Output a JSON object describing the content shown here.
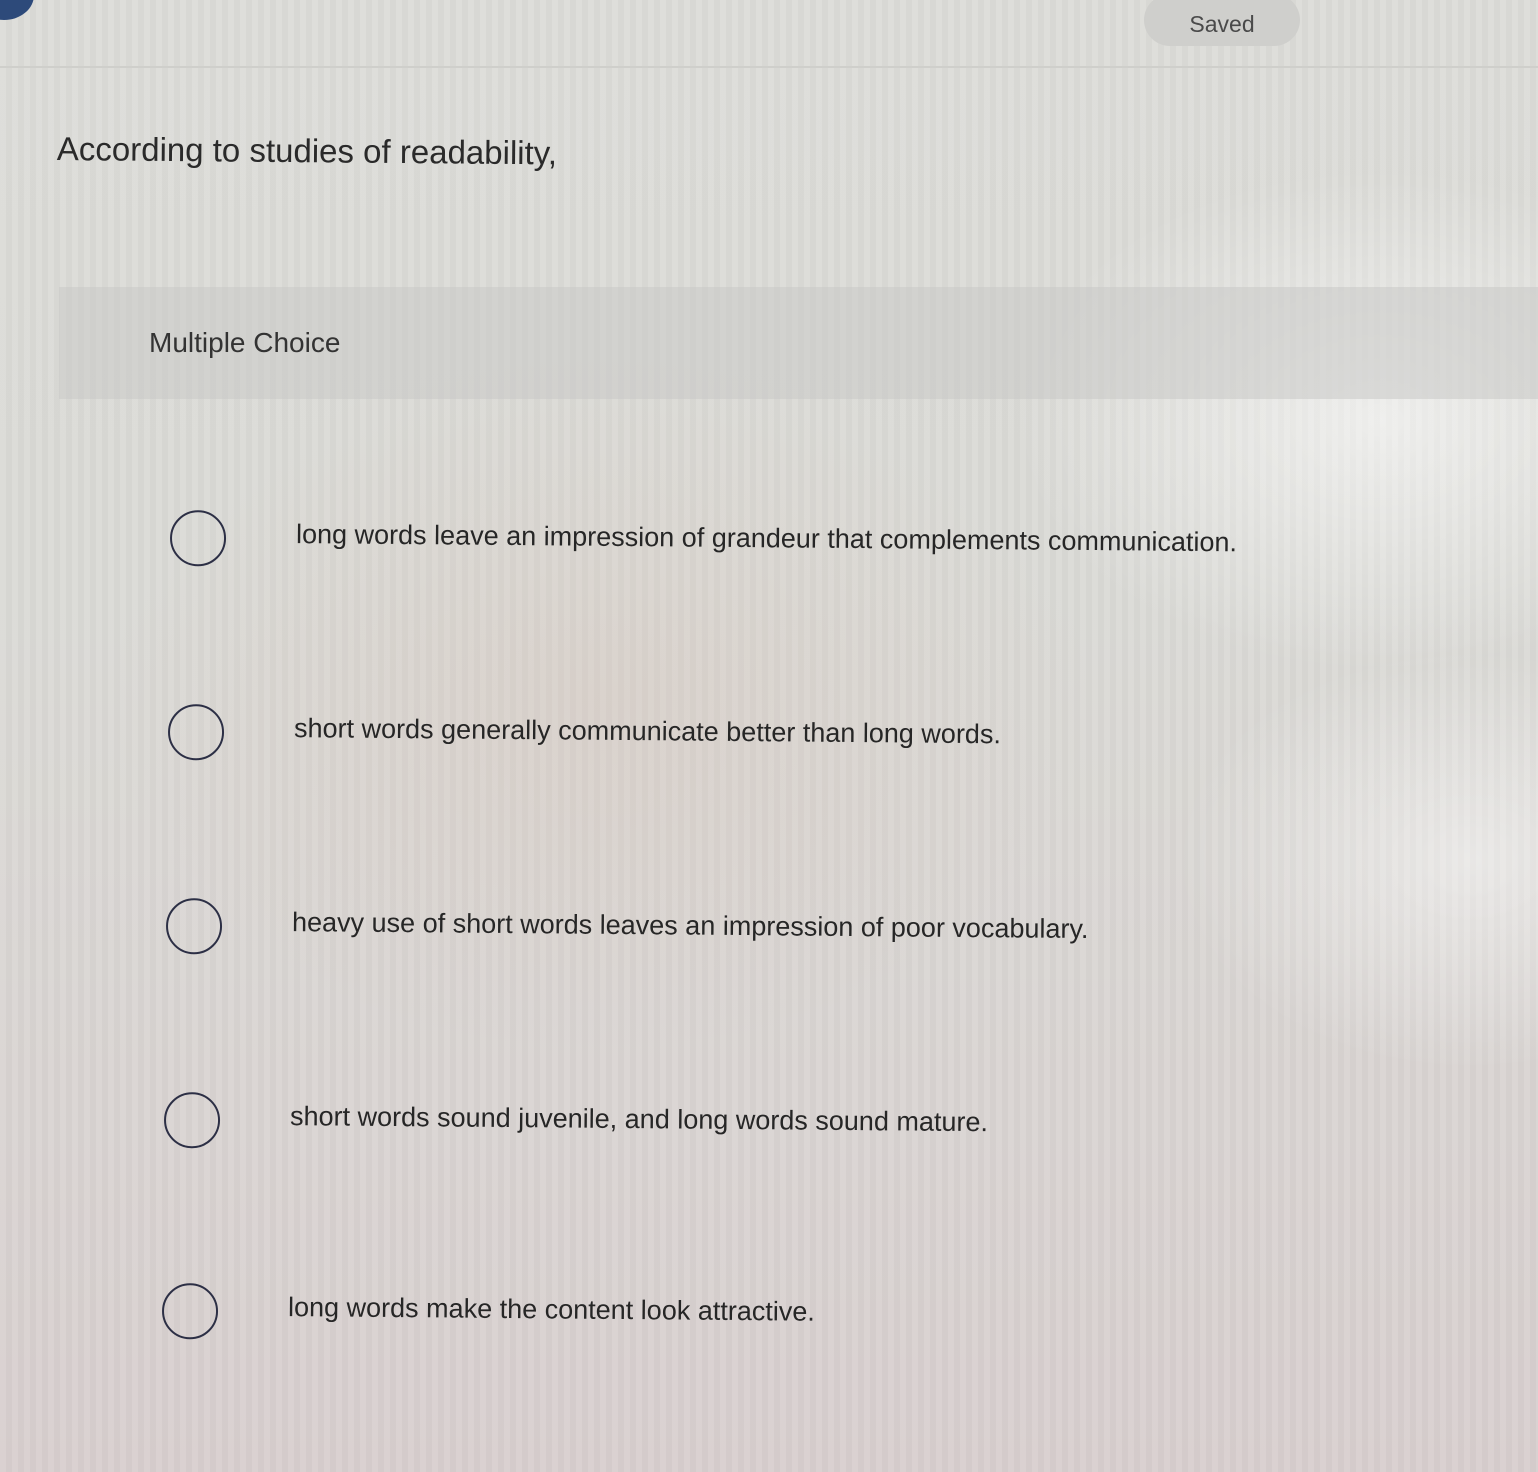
{
  "header": {
    "saved_label": "Saved"
  },
  "question": {
    "prompt": "According to studies of readability,"
  },
  "multiple_choice": {
    "label": "Multiple Choice",
    "options": [
      "long words leave an impression of grandeur that complements communication.",
      "short words generally communicate better than long words.",
      "heavy use of short words leaves an impression of poor vocabulary.",
      "short words sound juvenile, and long words sound mature.",
      "long words make the content look attractive."
    ]
  },
  "icons": {
    "top_left": "info-icon",
    "option_control": "radio-circle"
  },
  "colors": {
    "radio_border": "#2c2f45",
    "badge_bg": "#cfcfcc",
    "icon_blue": "#2d4a7a"
  }
}
